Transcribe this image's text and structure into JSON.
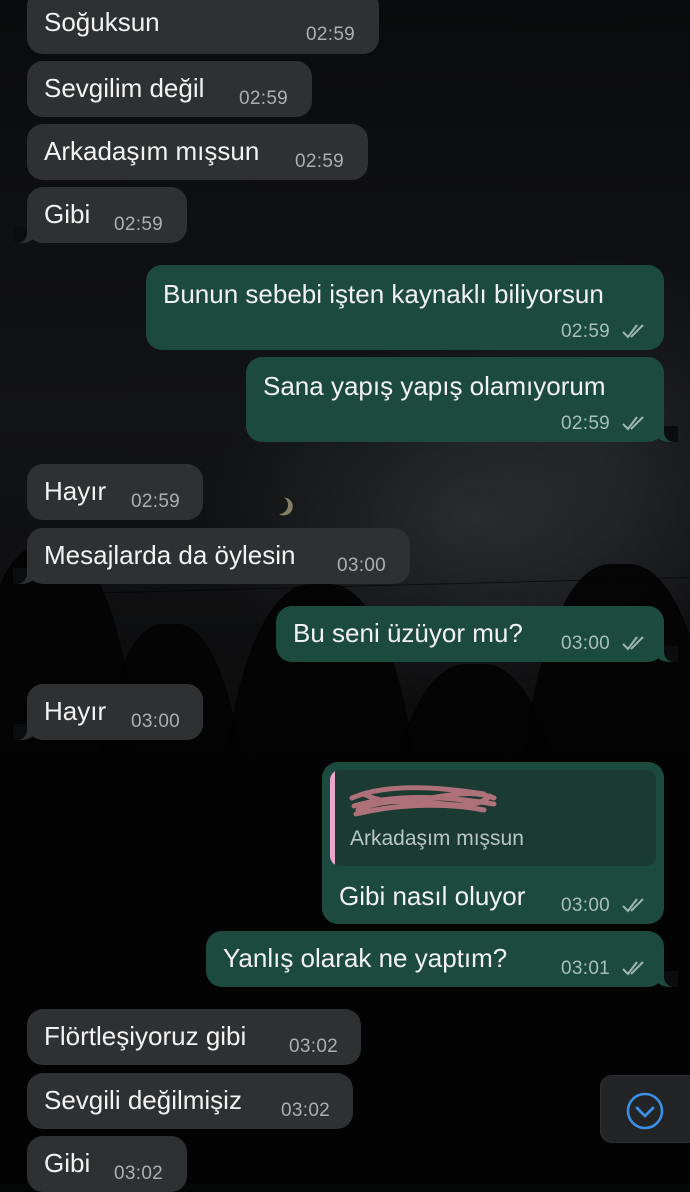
{
  "messages": [
    {
      "text": "Soğuksun",
      "time": "02:59",
      "dir": "in"
    },
    {
      "text": "Sevgilim değil",
      "time": "02:59",
      "dir": "in"
    },
    {
      "text": "Arkadaşım mışsun",
      "time": "02:59",
      "dir": "in"
    },
    {
      "text": "Gibi",
      "time": "02:59",
      "dir": "in"
    },
    {
      "text": "Bunun sebebi işten kaynaklı biliyorsun",
      "time": "02:59",
      "dir": "out",
      "status": "read"
    },
    {
      "text": "Sana yapış yapış olamıyorum",
      "time": "02:59",
      "dir": "out",
      "status": "read"
    },
    {
      "text": "Hayır",
      "time": "02:59",
      "dir": "in"
    },
    {
      "text": "Mesajlarda da öylesin",
      "time": "03:00",
      "dir": "in"
    },
    {
      "text": "Bu seni üzüyor mu?",
      "time": "03:00",
      "dir": "out",
      "status": "read"
    },
    {
      "text": "Hayır",
      "time": "03:00",
      "dir": "in"
    },
    {
      "text": "Gibi nasıl oluyor",
      "time": "03:00",
      "dir": "out",
      "status": "read",
      "reply_to": "Arkadaşım mışsun"
    },
    {
      "text": "Yanlış olarak ne yaptım?",
      "time": "03:01",
      "dir": "out",
      "status": "read"
    },
    {
      "text": "Flörtleşiyoruz gibi",
      "time": "03:02",
      "dir": "in"
    },
    {
      "text": "Sevgili değilmişiz",
      "time": "03:02",
      "dir": "in"
    },
    {
      "text": "Gibi",
      "time": "03:02",
      "dir": "in"
    }
  ],
  "icons": {
    "read_receipt": "double-check-icon",
    "scroll_down": "chevron-down-circle-icon"
  },
  "colors": {
    "incoming_bubble": "#2f3031",
    "outgoing_bubble": "#1d4a3f",
    "quote_accent": "#e8a6c8",
    "scroll_accent": "#3b8fe6"
  }
}
